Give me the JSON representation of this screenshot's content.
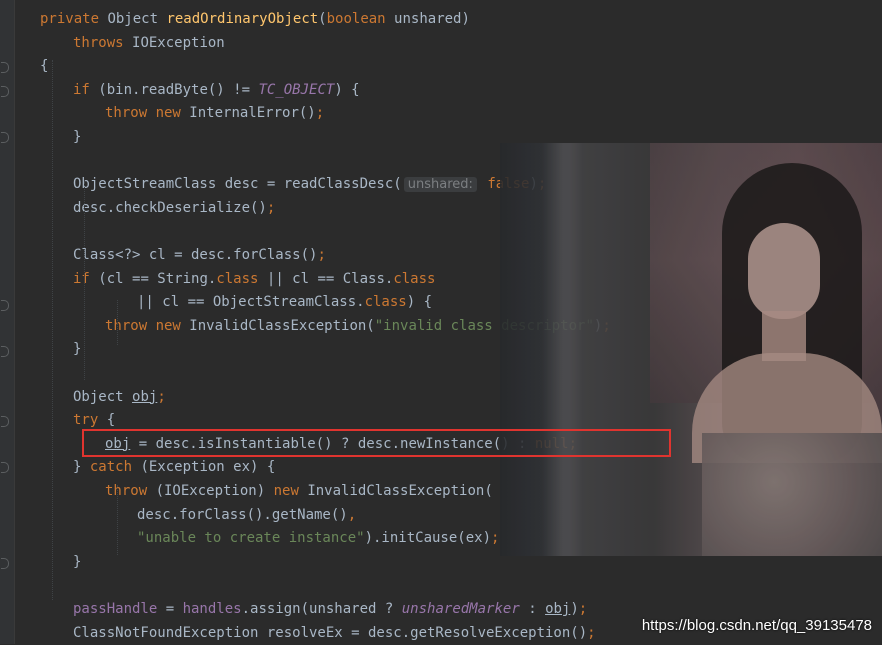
{
  "code_lines": [
    {
      "tokens": [
        [
          "kw",
          "private "
        ],
        [
          "",
          "Object "
        ],
        [
          "fn",
          "readOrdinaryObject"
        ],
        [
          "",
          "("
        ],
        [
          "kw",
          "boolean "
        ],
        [
          "",
          "unshared)"
        ]
      ]
    },
    {
      "tokens": [
        [
          "kw",
          "throws "
        ],
        [
          "",
          "IOException"
        ]
      ]
    },
    {
      "tokens": [
        [
          "",
          "{"
        ]
      ]
    },
    {
      "tokens": [
        [
          "kw",
          "if "
        ],
        [
          "",
          "(bin.readByte() != "
        ],
        [
          "const",
          "TC_OBJECT"
        ],
        [
          "",
          ") {"
        ]
      ]
    },
    {
      "tokens": [
        [
          "kw",
          "throw new "
        ],
        [
          "",
          "InternalError()"
        ],
        [
          "kw",
          ";"
        ]
      ]
    },
    {
      "tokens": [
        [
          "",
          "}"
        ]
      ]
    },
    {
      "tokens": []
    },
    {
      "tokens": [
        [
          "",
          "ObjectStreamClass desc = readClassDesc("
        ],
        [
          "hint",
          "unshared:"
        ],
        [
          "kw",
          " false"
        ],
        [
          "",
          ")"
        ],
        [
          "kw",
          ";"
        ]
      ]
    },
    {
      "tokens": [
        [
          "",
          "desc.checkDeserialize()"
        ],
        [
          "kw",
          ";"
        ]
      ]
    },
    {
      "tokens": []
    },
    {
      "tokens": [
        [
          "",
          "Class<?> cl = desc.forClass()"
        ],
        [
          "kw",
          ";"
        ]
      ]
    },
    {
      "tokens": [
        [
          "kw",
          "if "
        ],
        [
          "",
          "(cl == String."
        ],
        [
          "kw",
          "class "
        ],
        [
          "",
          "|| cl == Class."
        ],
        [
          "kw",
          "class"
        ]
      ]
    },
    {
      "tokens": [
        [
          "",
          "|| cl == ObjectStreamClass."
        ],
        [
          "kw",
          "class"
        ],
        [
          "",
          ") {"
        ]
      ]
    },
    {
      "tokens": [
        [
          "kw",
          "throw new "
        ],
        [
          "",
          "InvalidClassException("
        ],
        [
          "str",
          "\"invalid class descriptor\""
        ],
        [
          "",
          ")"
        ],
        [
          "kw",
          ";"
        ]
      ]
    },
    {
      "tokens": [
        [
          "",
          "}"
        ]
      ]
    },
    {
      "tokens": []
    },
    {
      "tokens": [
        [
          "",
          "Object "
        ],
        [
          "ul",
          "obj"
        ],
        [
          "kw",
          ";"
        ]
      ]
    },
    {
      "tokens": [
        [
          "kw",
          "try "
        ],
        [
          "",
          "{"
        ]
      ]
    },
    {
      "tokens": [
        [
          "ul",
          "obj"
        ],
        [
          "",
          ""
        ],
        [
          ".",
          " = desc.isInstantiable() ? desc.newInstance() : "
        ],
        [
          "kw",
          "null;"
        ]
      ]
    },
    {
      "tokens": [
        [
          "",
          "} "
        ],
        [
          "kw",
          "catch "
        ],
        [
          "",
          "(Exception ex) {"
        ]
      ]
    },
    {
      "tokens": [
        [
          "kw",
          "throw "
        ],
        [
          "",
          "(IOException) "
        ],
        [
          "kw",
          "new "
        ],
        [
          "",
          "InvalidClassException("
        ]
      ]
    },
    {
      "tokens": [
        [
          "",
          "desc.forClass().getName()"
        ],
        [
          "kw",
          ","
        ]
      ]
    },
    {
      "tokens": [
        [
          "str",
          "\"unable to create instance\""
        ],
        [
          "",
          ").initCause(ex)"
        ],
        [
          "kw",
          ";"
        ]
      ]
    },
    {
      "tokens": [
        [
          "",
          "}"
        ]
      ]
    },
    {
      "tokens": []
    },
    {
      "tokens": [
        [
          "field",
          "passHandle "
        ],
        [
          "",
          "= "
        ],
        [
          "field",
          "handles"
        ],
        [
          "",
          ".assign(unshared ? "
        ],
        [
          "const",
          "unsharedMarker"
        ],
        [
          "",
          " : "
        ],
        [
          "ul",
          "obj"
        ],
        [
          "",
          ")"
        ],
        [
          "kw",
          ";"
        ]
      ]
    },
    {
      "tokens": [
        [
          "",
          "ClassNotFoundException resolveEx = desc.getResolveException()"
        ],
        [
          "kw",
          ";"
        ]
      ]
    }
  ],
  "watermark": "https://blog.csdn.net/qq_39135478"
}
